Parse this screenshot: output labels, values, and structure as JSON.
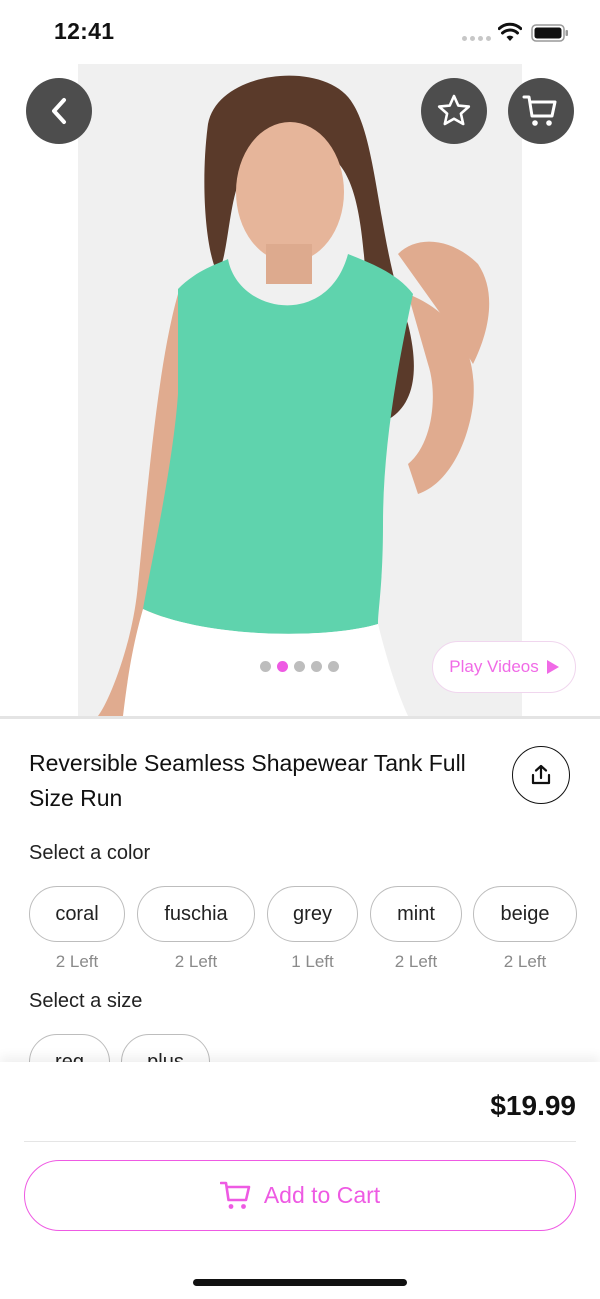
{
  "status_bar": {
    "time": "12:41"
  },
  "hero": {
    "image_description_icon": "product-photo",
    "pager": {
      "count": 5,
      "active_index": 1
    },
    "play_videos_label": "Play Videos"
  },
  "colors": {
    "accent": "#ee5ae3",
    "top_fill": "#5fd3ad",
    "button_dark": "#4d4d4d"
  },
  "product": {
    "title": "Reversible Seamless Shapewear Tank Full Size Run"
  },
  "color_section": {
    "label": "Select a color",
    "options": [
      {
        "name": "coral",
        "stock": "2 Left"
      },
      {
        "name": "fuschia",
        "stock": "2 Left"
      },
      {
        "name": "grey",
        "stock": "1 Left"
      },
      {
        "name": "mint",
        "stock": "2 Left"
      },
      {
        "name": "beige",
        "stock": "2 Left"
      }
    ]
  },
  "size_section": {
    "label": "Select a size",
    "options": [
      "reg",
      "plus"
    ]
  },
  "checkout": {
    "price": "$19.99",
    "add_to_cart_label": "Add to Cart"
  }
}
